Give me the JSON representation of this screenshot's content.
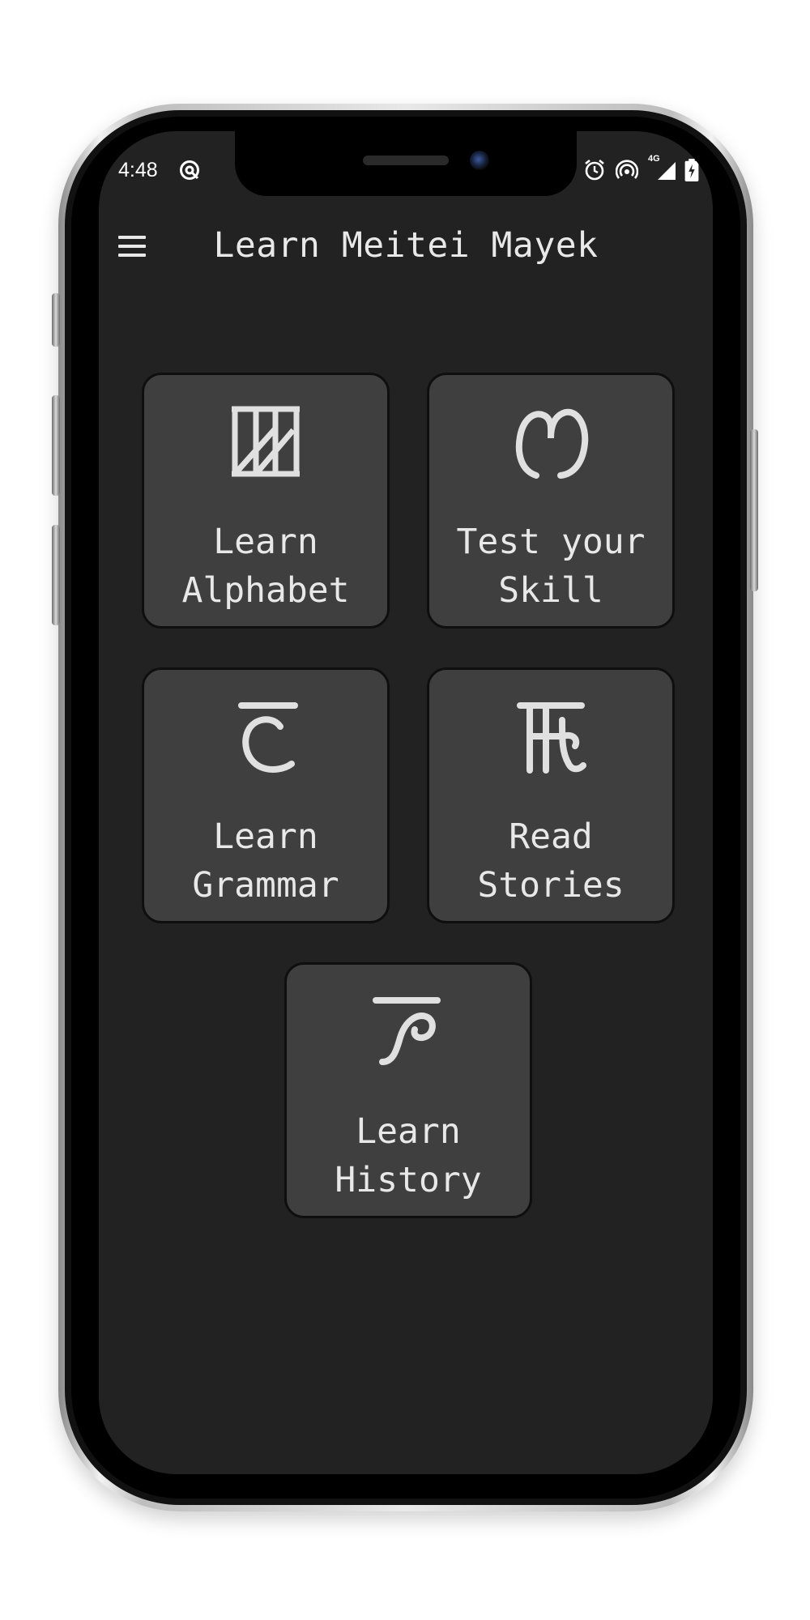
{
  "status_bar": {
    "time": "4:48",
    "network_label": "4G",
    "icons": [
      "sync-icon",
      "alarm-icon",
      "hotspot-icon",
      "signal-icon",
      "battery-charging-icon"
    ]
  },
  "app_bar": {
    "menu_icon": "hamburger-menu-icon",
    "title": "Learn Meitei Mayek"
  },
  "menu_cards": [
    {
      "line1": "Learn",
      "line2": "Alphabet",
      "icon": "meitei-letter-kok-icon"
    },
    {
      "line1": "Test your",
      "line2": "Skill",
      "icon": "meitei-letter-sam-icon"
    },
    {
      "line1": "Learn",
      "line2": "Grammar",
      "icon": "meitei-letter-lai-icon"
    },
    {
      "line1": "Read",
      "line2": "Stories",
      "icon": "meitei-letter-mit-icon"
    },
    {
      "line1": "Learn",
      "line2": "History",
      "icon": "meitei-letter-pa-icon"
    }
  ],
  "colors": {
    "screen_background": "#222222",
    "card_background": "#3f3f3f",
    "card_border": "#0f0f0f",
    "text": "#e8e8e8"
  }
}
